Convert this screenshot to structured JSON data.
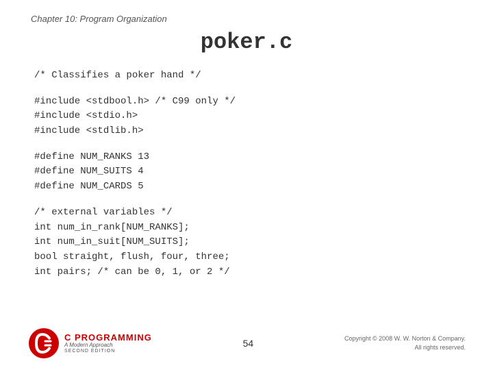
{
  "slide": {
    "chapter_title": "Chapter 10: Program Organization",
    "file_title": "poker.c",
    "code": {
      "comment_intro": "/* Classifies a poker hand */",
      "includes": [
        "#include <stdbool.h>   /* C99 only */",
        "#include <stdio.h>",
        "#include <stdlib.h>"
      ],
      "defines": [
        "#define NUM_RANKS 13",
        "#define NUM_SUITS 4",
        "#define NUM_CARDS 5"
      ],
      "variables_comment": "/* external variables */",
      "variables": [
        "int num_in_rank[NUM_RANKS];",
        "int num_in_suit[NUM_SUITS];",
        "bool straight, flush, four, three;",
        "int pairs;   /* can be 0, 1, or 2 */"
      ]
    },
    "footer": {
      "page_number": "54",
      "copyright_line1": "Copyright © 2008 W. W. Norton & Company.",
      "copyright_line2": "All rights reserved.",
      "logo_main": "C PROGRAMMING",
      "logo_sub": "A Modern Approach",
      "logo_edition": "SECOND EDITION"
    }
  }
}
